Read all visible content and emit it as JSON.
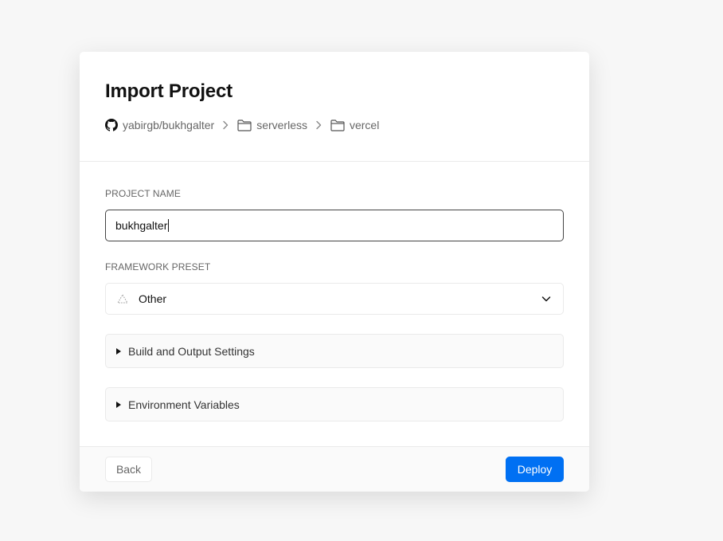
{
  "page": {
    "title": "Import Project"
  },
  "breadcrumb": {
    "repo": "yabirgb/bukhgalter",
    "folder1": "serverless",
    "folder2": "vercel"
  },
  "project_name": {
    "label": "PROJECT NAME",
    "value": "bukhgalter"
  },
  "framework": {
    "label": "FRAMEWORK PRESET",
    "value": "Other"
  },
  "sections": {
    "build": "Build and Output Settings",
    "env": "Environment Variables"
  },
  "footer": {
    "back_label": "Back",
    "deploy_label": "Deploy"
  },
  "colors": {
    "accent": "#0070f3",
    "background": "#f7f7f7",
    "card": "#ffffff"
  }
}
